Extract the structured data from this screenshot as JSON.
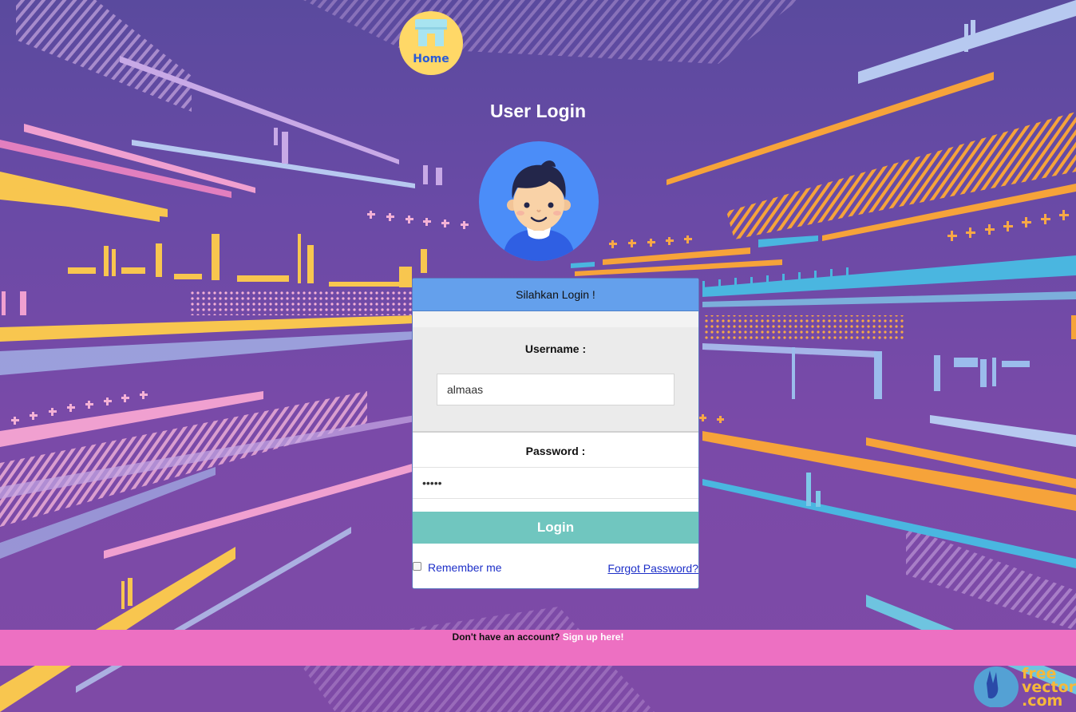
{
  "header": {
    "home_label": "Home",
    "title": "User Login"
  },
  "panel": {
    "header": "Silahkan Login !",
    "username_label": "Username :",
    "username_value": "almaas",
    "password_label": "Password :",
    "password_mask": "•••••",
    "login_button": "Login",
    "remember_label": "Remember me",
    "remember_checked": false,
    "forgot_link": "Forgot Password?"
  },
  "footer": {
    "prompt": "Don't have an account?",
    "signup_link": "Sign up here!"
  },
  "watermark": {
    "text_line1": "free",
    "text_line2": "vector",
    "text_line3": ".com"
  },
  "colors": {
    "header_bar": "#64a0ec",
    "login_button": "#70c6bf",
    "footer_bar": "#ed70c2",
    "home_circle": "#ffd867",
    "avatar_circle": "#4b8df8",
    "link": "#1d2fc8"
  }
}
